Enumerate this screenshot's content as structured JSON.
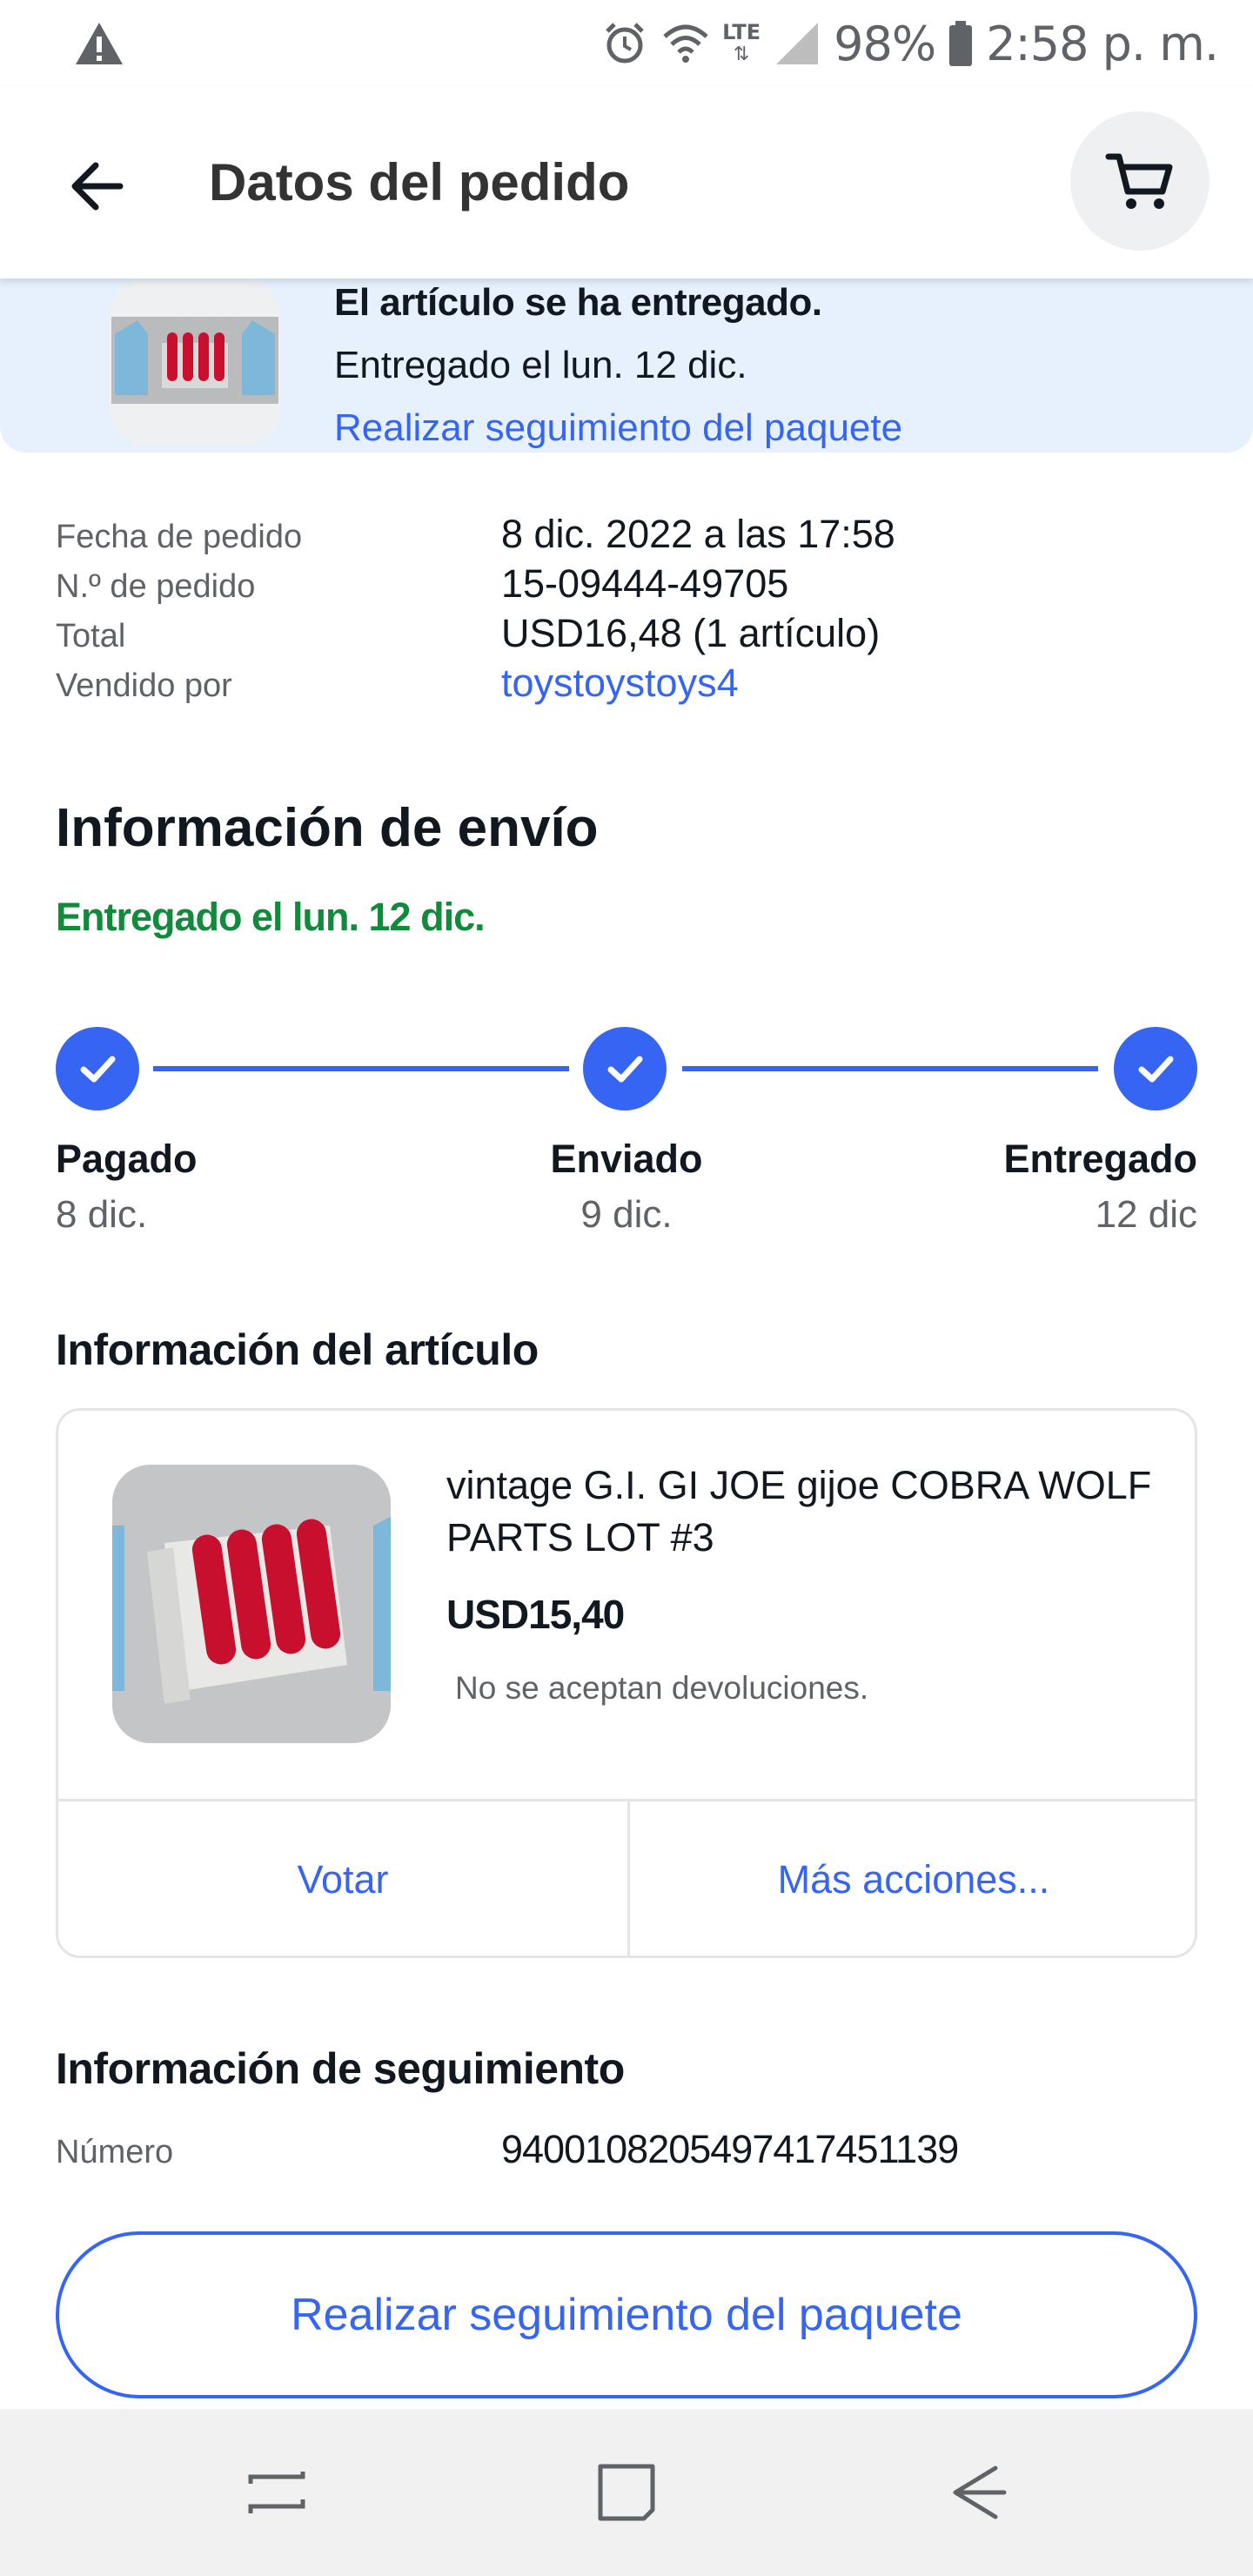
{
  "status_bar": {
    "battery": "98%",
    "time": "2:58 p. m.",
    "network": "LTE"
  },
  "header": {
    "title": "Datos del pedido"
  },
  "banner": {
    "title": "El artículo se ha entregado.",
    "subtitle": "Entregado el lun. 12 dic.",
    "track_link": "Realizar seguimiento del paquete"
  },
  "order": {
    "rows": [
      {
        "label": "Fecha de pedido",
        "value": "8 dic. 2022 a las 17:58"
      },
      {
        "label": "N.º de pedido",
        "value": "15-09444-49705"
      },
      {
        "label": "Total",
        "value": "USD16,48 (1 artículo)"
      },
      {
        "label": "Vendido por",
        "value": "toystoystoys4"
      }
    ]
  },
  "shipping": {
    "title": "Información de envío",
    "status": "Entregado el lun. 12 dic.",
    "steps": [
      {
        "name": "Pagado",
        "date": "8 dic."
      },
      {
        "name": "Enviado",
        "date": "9 dic."
      },
      {
        "name": "Entregado",
        "date": "12 dic"
      }
    ]
  },
  "item": {
    "heading": "Información del artículo",
    "title": "vintage G.I. GI JOE gijoe COBRA WOLF PARTS LOT #3",
    "price": "USD15,40",
    "returns": "No se aceptan devoluciones.",
    "action_left": "Votar",
    "action_right": "Más acciones..."
  },
  "tracking": {
    "heading": "Información de seguimiento",
    "label": "Número",
    "number": "9400108205497417451139",
    "button": "Realizar seguimiento del paquete"
  },
  "colors": {
    "accent": "#3665f3",
    "success": "#118a3c",
    "banner_bg": "#e6f1fd"
  }
}
